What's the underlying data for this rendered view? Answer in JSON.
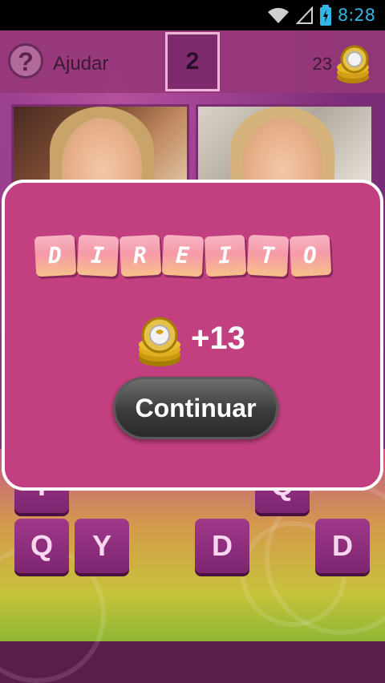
{
  "status_bar": {
    "time": "8:28"
  },
  "header": {
    "help_label": "Ajudar",
    "level": "2",
    "coins": "23"
  },
  "keyboard": {
    "row1": [
      "T",
      "Q"
    ],
    "row2": [
      "Q",
      "Y",
      "D",
      "D"
    ]
  },
  "modal": {
    "word_letters": [
      "D",
      "I",
      "R",
      "E",
      "I",
      "T",
      "O"
    ],
    "reward": "+13",
    "continue_label": "Continuar"
  },
  "colors": {
    "modal_background": "#c2407f",
    "status_accent": "#33b5e5",
    "button": "#3c3c3c"
  }
}
